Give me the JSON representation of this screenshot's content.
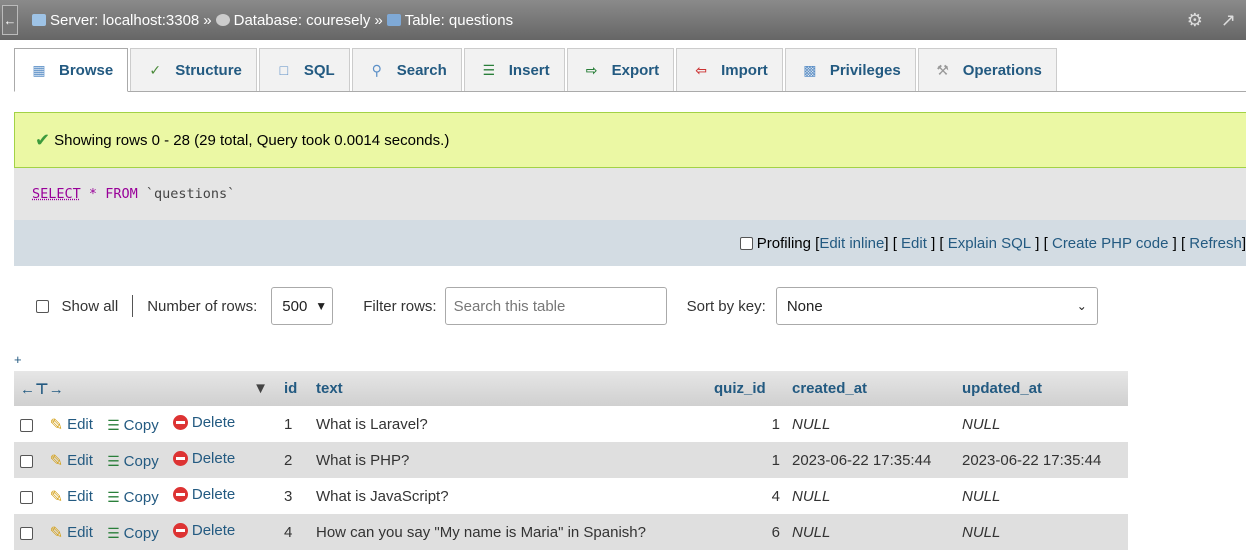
{
  "topbar": {
    "server": "Server: localhost:3308",
    "database": "Database: couresely",
    "table": "Table: questions",
    "sep": "»"
  },
  "tabs": [
    {
      "label": "Browse",
      "icon": "browse-icon"
    },
    {
      "label": "Structure",
      "icon": "structure-icon"
    },
    {
      "label": "SQL",
      "icon": "sql-icon"
    },
    {
      "label": "Search",
      "icon": "search-icon"
    },
    {
      "label": "Insert",
      "icon": "insert-icon"
    },
    {
      "label": "Export",
      "icon": "export-icon"
    },
    {
      "label": "Import",
      "icon": "import-icon"
    },
    {
      "label": "Privileges",
      "icon": "privileges-icon"
    },
    {
      "label": "Operations",
      "icon": "operations-icon"
    }
  ],
  "message": "Showing rows 0 - 28 (29 total, Query took 0.0014 seconds.)",
  "sql": {
    "select": "SELECT",
    "star": "*",
    "from": "FROM",
    "table": "`questions`"
  },
  "tools": {
    "profiling": "Profiling",
    "edit_inline": "Edit inline",
    "edit": "Edit",
    "explain": "Explain SQL",
    "php": "Create PHP code",
    "refresh": "Refresh"
  },
  "nav": {
    "show_all": "Show all",
    "number_of_rows": "Number of rows:",
    "rows_value": "500",
    "filter_rows": "Filter rows:",
    "search_placeholder": "Search this table",
    "sort_by_key": "Sort by key:",
    "sort_value": "None"
  },
  "table": {
    "columns": {
      "id": "id",
      "text": "text",
      "quiz_id": "quiz_id",
      "created_at": "created_at",
      "updated_at": "updated_at"
    },
    "actions": {
      "edit": "Edit",
      "copy": "Copy",
      "delete": "Delete"
    },
    "rows": [
      {
        "id": "1",
        "text": "What is Laravel?",
        "quiz_id": "1",
        "created_at": "NULL",
        "updated_at": "NULL"
      },
      {
        "id": "2",
        "text": "What is PHP?",
        "quiz_id": "1",
        "created_at": "2023-06-22 17:35:44",
        "updated_at": "2023-06-22 17:35:44"
      },
      {
        "id": "3",
        "text": "What is JavaScript?",
        "quiz_id": "4",
        "created_at": "NULL",
        "updated_at": "NULL"
      },
      {
        "id": "4",
        "text": "How can you say \"My name is Maria\" in Spanish?",
        "quiz_id": "6",
        "created_at": "NULL",
        "updated_at": "NULL"
      }
    ]
  },
  "colors": {
    "link": "#235a81",
    "success_bg": "#ebf8a4",
    "header_bar": "#666666"
  }
}
